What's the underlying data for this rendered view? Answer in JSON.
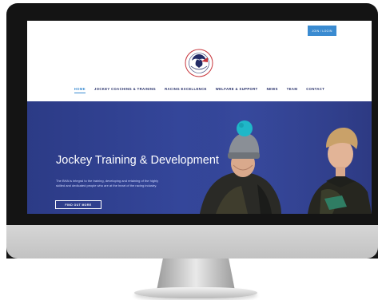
{
  "header": {
    "top_button_label": "JOIN / LOGIN",
    "logo_text": "JOCKEY TRAINING"
  },
  "nav": {
    "items": [
      {
        "label": "HOME",
        "active": true
      },
      {
        "label": "JOCKEY COACHING & TRAINING"
      },
      {
        "label": "RACING EXCELLENCE"
      },
      {
        "label": "WELFARE & SUPPORT"
      },
      {
        "label": "NEWS"
      },
      {
        "label": "TEAM"
      },
      {
        "label": "CONTACT"
      }
    ]
  },
  "hero": {
    "title": "Jockey Training & Development",
    "text": "The BHA is integral to the training, developing and retaining of the highly skilled and dedicated people who are at the heart of the racing industry.",
    "button_label": "FIND OUT MORE"
  },
  "colors": {
    "accent": "#3a8bd1",
    "nav_text": "#222b66",
    "hero_bg": "#2c3b86"
  }
}
